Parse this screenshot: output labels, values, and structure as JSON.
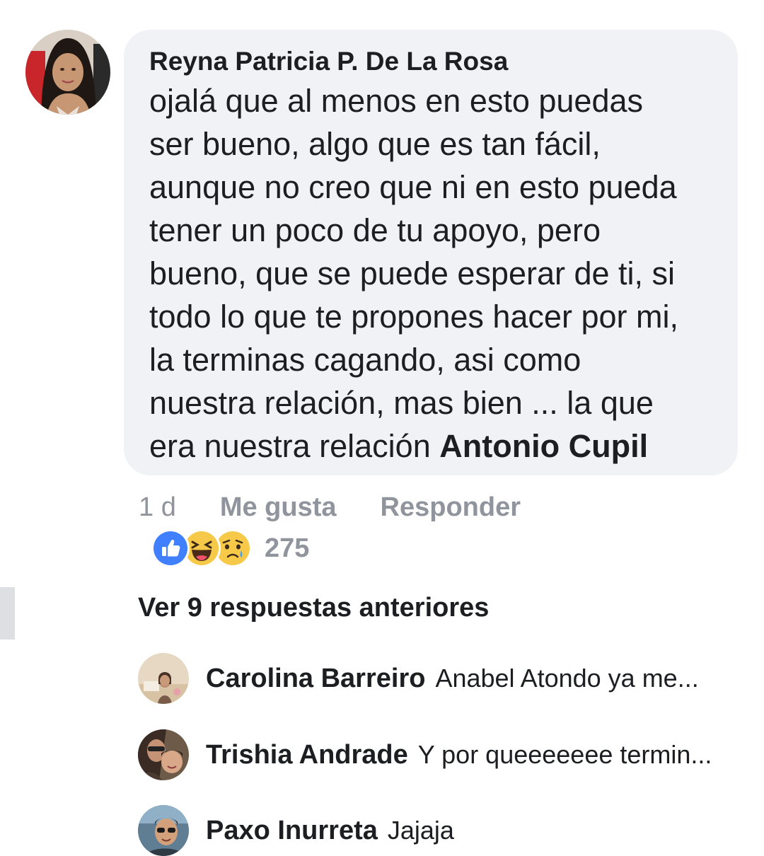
{
  "comment": {
    "author": "Reyna Patricia P. De La Rosa",
    "lines": [
      "ojalá que al menos en esto puedas",
      "ser bueno, algo que es tan fácil,",
      "aunque no creo que ni en esto pueda",
      "tener un poco de tu apoyo, pero",
      "bueno, que se puede esperar de ti, si",
      "todo lo que te propones hacer por mi,",
      "la terminas cagando, asi como",
      "nuestra relación, mas bien ... la que",
      "era nuestra relación "
    ],
    "mention": "Antonio Cupil",
    "time": "1 d",
    "like_label": "Me gusta",
    "reply_label": "Responder",
    "reaction_icons": [
      "like-icon",
      "haha-icon",
      "sad-icon"
    ],
    "reaction_count": "275"
  },
  "replies": {
    "view_previous": "Ver 9 respuestas anteriores",
    "items": [
      {
        "name": "Carolina Barreiro",
        "text": "Anabel Atondo ya me..."
      },
      {
        "name": "Trishia Andrade",
        "text": "Y por queeeeeee termin..."
      },
      {
        "name": "Paxo Inurreta",
        "text": "Jajaja"
      }
    ]
  },
  "colors": {
    "bubble_bg": "#f0f2f5",
    "meta_gray": "#90949c",
    "like_blue": "#4080ff",
    "emoji_yellow": "#f7c948"
  }
}
